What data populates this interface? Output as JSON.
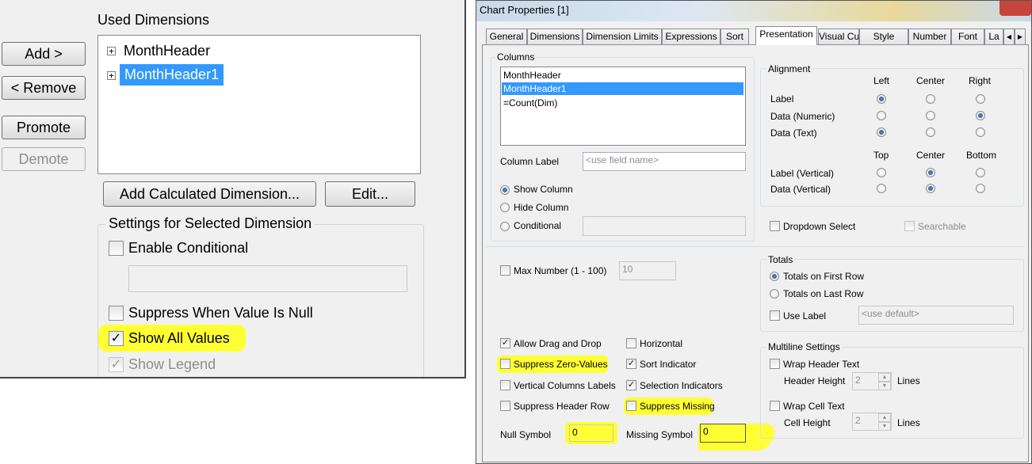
{
  "left": {
    "used_dimensions_label": "Used Dimensions",
    "buttons": {
      "add": "Add >",
      "remove": "< Remove",
      "promote": "Promote",
      "demote": "Demote",
      "add_calculated": "Add Calculated Dimension...",
      "edit": "Edit..."
    },
    "dimensions": [
      {
        "label": "MonthHeader",
        "selected": false
      },
      {
        "label": "MonthHeader1",
        "selected": true
      }
    ],
    "expander_glyph": "+",
    "settings_title": "Settings for Selected Dimension",
    "enable_conditional": "Enable Conditional",
    "suppress_null": "Suppress When Value Is Null",
    "show_all_values": "Show All Values",
    "show_legend": "Show Legend",
    "check_glyph": "✓",
    "highlight_color": "#ffff33"
  },
  "right": {
    "window_title": "Chart Properties [1]",
    "tabs": [
      "General",
      "Dimensions",
      "Dimension Limits",
      "Expressions",
      "Sort",
      "Presentation",
      "Visual Cues",
      "Style",
      "Number",
      "Font",
      "La"
    ],
    "active_tab": "Presentation",
    "columns": {
      "title": "Columns",
      "items": [
        "MonthHeader",
        "MonthHeader1",
        "=Count(Dim)"
      ],
      "selected": "MonthHeader1",
      "column_label": "Column Label",
      "column_label_placeholder": "<use field name>",
      "show_column": "Show Column",
      "hide_column": "Hide Column",
      "conditional": "Conditional"
    },
    "alignment": {
      "title": "Alignment",
      "h_headers": [
        "Left",
        "Center",
        "Right"
      ],
      "v_headers": [
        "Top",
        "Center",
        "Bottom"
      ],
      "rows": [
        {
          "label": "Label",
          "selected": "Left"
        },
        {
          "label": "Data (Numeric)",
          "selected": "Right"
        },
        {
          "label": "Data (Text)",
          "selected": "Left"
        },
        {
          "label": "Label (Vertical)",
          "selected": "Center"
        },
        {
          "label": "Data (Vertical)",
          "selected": "Center"
        }
      ]
    },
    "dropdown_select": "Dropdown Select",
    "searchable": "Searchable",
    "max_number": "Max Number (1 - 100)",
    "max_number_value": "10",
    "totals": {
      "title": "Totals",
      "first_row": "Totals on First Row",
      "last_row": "Totals on Last Row",
      "use_label": "Use Label",
      "use_label_placeholder": "<use default>"
    },
    "options": {
      "allow_drag_drop": "Allow Drag and Drop",
      "horizontal": "Horizontal",
      "suppress_zero": "Suppress Zero-Values",
      "sort_indicator": "Sort Indicator",
      "vertical_column_labels": "Vertical Columns Labels",
      "selection_indicators": "Selection Indicators",
      "suppress_header_row": "Suppress Header Row",
      "suppress_missing": "Suppress Missing"
    },
    "multiline": {
      "title": "Multiline Settings",
      "wrap_header": "Wrap Header Text",
      "header_height": "Header Height",
      "header_height_value": "2",
      "wrap_cell": "Wrap Cell Text",
      "cell_height": "Cell Height",
      "cell_height_value": "2",
      "lines": "Lines"
    },
    "null_symbol": "Null Symbol",
    "null_symbol_value": "0",
    "missing_symbol": "Missing Symbol",
    "missing_symbol_value": "0",
    "check_glyph": "✓",
    "spin_up_glyph": "▲",
    "spin_down_glyph": "▼",
    "colors": {
      "selection": "#3399ff",
      "highlight": "#ffff33",
      "close_button": "#c7463b"
    }
  }
}
